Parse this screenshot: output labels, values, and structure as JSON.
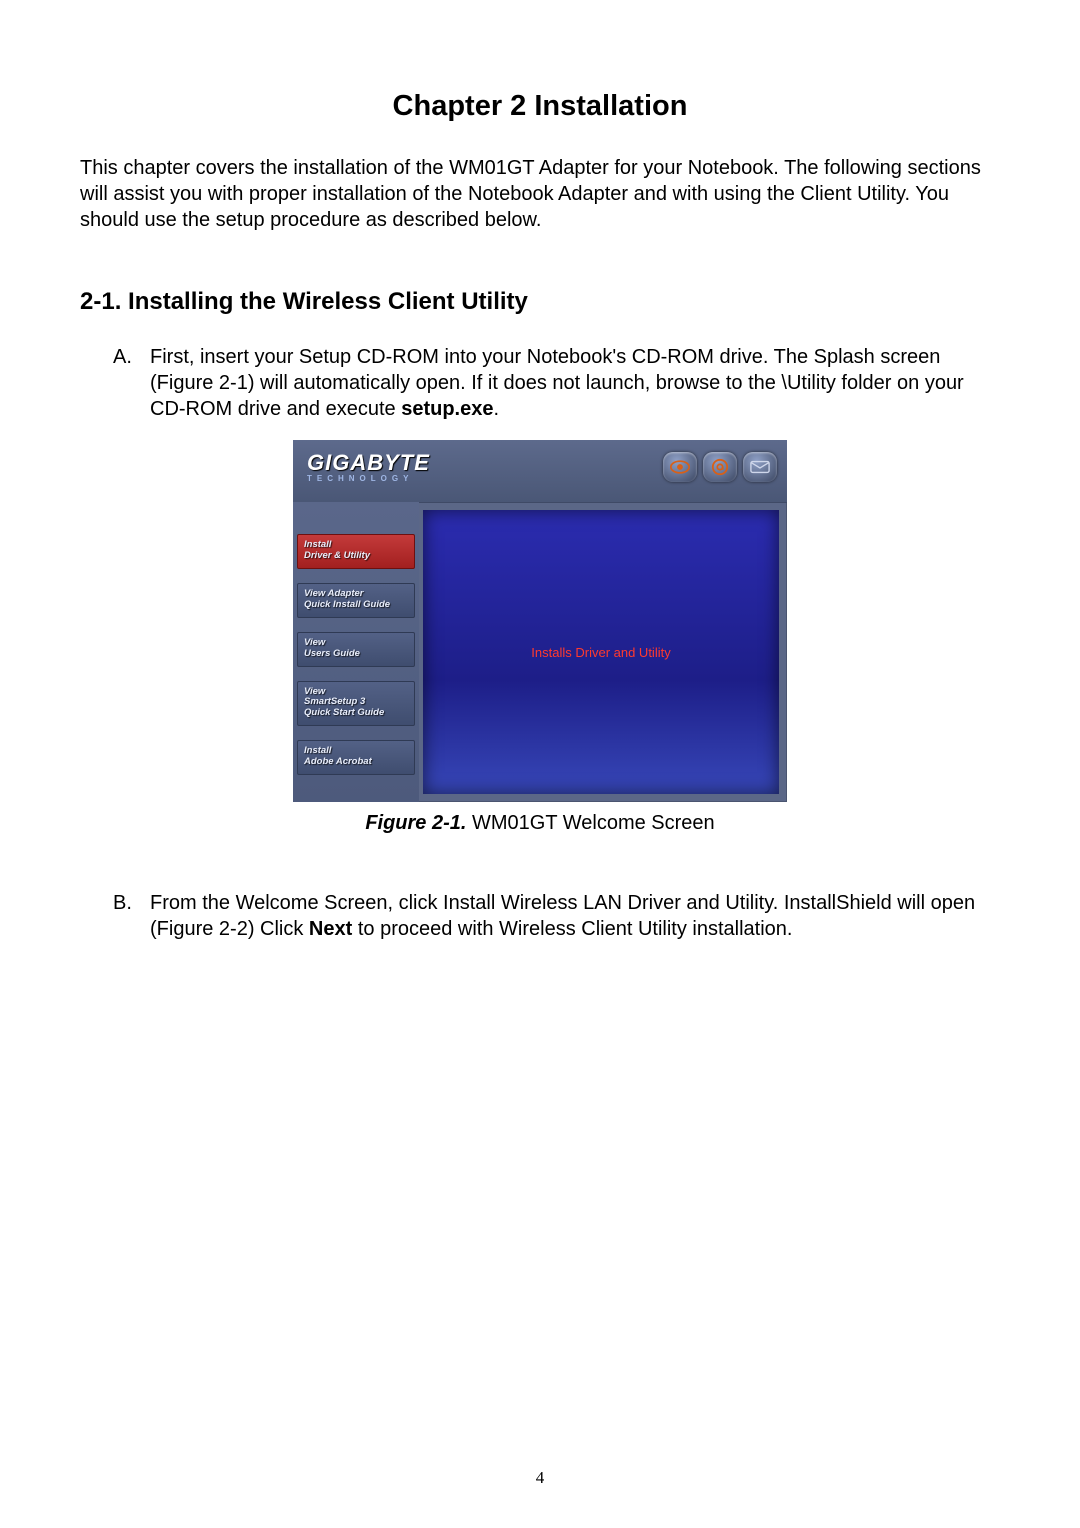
{
  "chapter_title": "Chapter 2    Installation",
  "intro": "This chapter covers the installation of the WM01GT Adapter for your Notebook.    The following sections will assist you with proper installation of the Notebook Adapter and with using the Client Utility. You should use the setup procedure as described below.",
  "section_title": "2-1.  Installing the Wireless Client Utility",
  "steps": {
    "a": {
      "marker": "A.",
      "text_before": "First, insert your Setup CD-ROM into your Notebook's CD-ROM drive. The Splash screen (Figure 2-1) will automatically open. If it does not launch, browse to the \\Utility folder on your CD-ROM drive and execute ",
      "bold": "setup.exe",
      "text_after": "."
    },
    "b": {
      "marker": "B.",
      "text_before": "From the Welcome Screen, click Install Wireless LAN Driver and Utility. InstallShield will open (Figure 2-2)    Click ",
      "bold": "Next",
      "text_after": " to proceed with Wireless Client Utility installation."
    }
  },
  "splash": {
    "logo_text": "GIGABYTE",
    "logo_sub": "TECHNOLOGY",
    "buttons": [
      "Install\nDriver & Utility",
      "View Adapter\nQuick Install Guide",
      "View\nUsers Guide",
      "View\nSmartSetup 3\nQuick Start Guide",
      "Install\nAdobe Acrobat"
    ],
    "content_text": "Installs Driver and Utility"
  },
  "caption": {
    "label": "Figure 2-1.",
    "text": "    WM01GT Welcome Screen"
  },
  "page_number": "4"
}
